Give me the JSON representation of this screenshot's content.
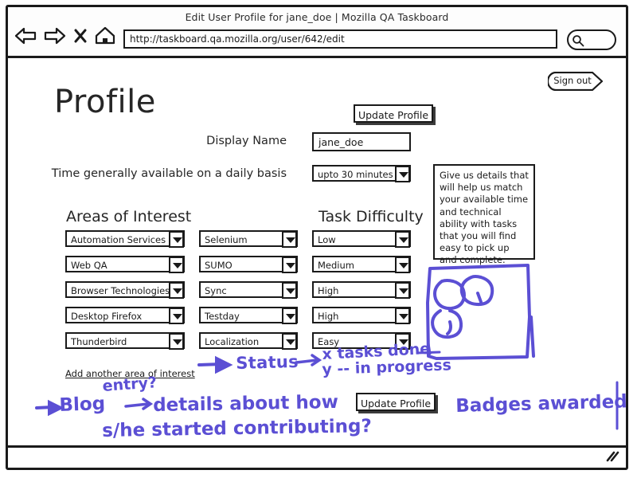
{
  "window": {
    "title": "Edit User Profile for jane_doe | Mozilla QA Taskboard",
    "url": "http://taskboard.qa.mozilla.org/user/642/edit",
    "nav": {
      "back": "back-arrow",
      "forward": "forward-arrow",
      "stop": "stop-x",
      "home": "home"
    },
    "search_icon": "magnifier-icon",
    "resize_grip": "resize-grip"
  },
  "page": {
    "title": "Profile",
    "sign_out_label": "Sign out",
    "update_profile_top_label": "Update Profile",
    "update_profile_bottom_label": "Update Profile",
    "display_name_label": "Display Name",
    "display_name_value": "jane_doe",
    "time_label": "Time generally available on a daily basis",
    "time_value": "upto 30 minutes",
    "add_area_link": "Add another area of interest",
    "help_text": "Give us details that will help us match your available time and technical ability with tasks that you will find easy to pick up and complete.",
    "sections": {
      "interest_heading": "Areas of Interest",
      "difficulty_heading": "Task Difficulty"
    },
    "columns": {
      "interest_primary": [
        "Automation Services",
        "Web QA",
        "Browser Technologies",
        "Desktop Firefox",
        "Thunderbird"
      ],
      "interest_secondary": [
        "Selenium",
        "SUMO",
        "Sync",
        "Testday",
        "Localization"
      ],
      "difficulty": [
        "Low",
        "Medium",
        "High",
        "High",
        "Easy"
      ]
    }
  },
  "annotations": {
    "ink_color": "#5b4fd4",
    "status": "Status",
    "tasks_done": "x tasks done",
    "in_progress": "y -- in progress",
    "blog": "Blog",
    "entry": "entry?",
    "details": "details about how",
    "line2": "s/he started contributing?",
    "badges": "Badges awarded",
    "badge_sketch": "hand-drawn-box-with-three-circles"
  }
}
